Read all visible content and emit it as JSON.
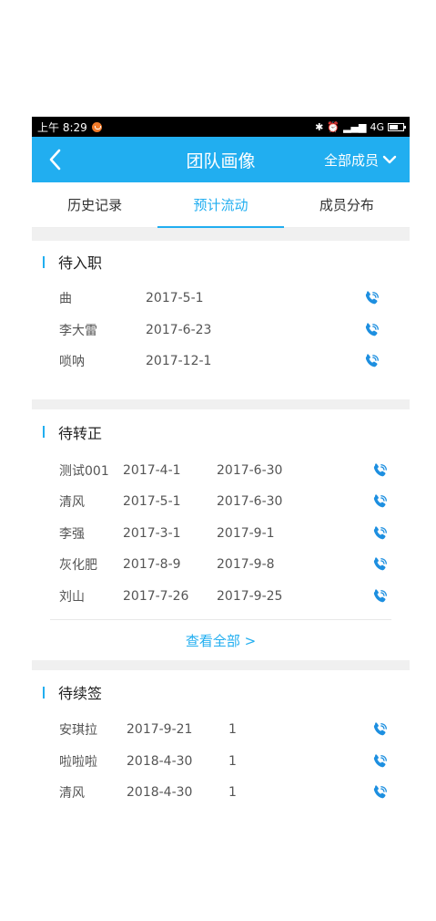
{
  "status_bar": {
    "time": "上午 8:29",
    "network": "4G"
  },
  "header": {
    "title": "团队画像",
    "member_filter": "全部成员"
  },
  "tabs": [
    {
      "label": "历史记录",
      "active": false
    },
    {
      "label": "预计流动",
      "active": true
    },
    {
      "label": "成员分布",
      "active": false
    }
  ],
  "sections": {
    "pending_entry": {
      "title": "待入职",
      "rows": [
        {
          "name": "曲",
          "date": "2017-5-1"
        },
        {
          "name": "李大雷",
          "date": "2017-6-23"
        },
        {
          "name": "唢呐",
          "date": "2017-12-1"
        }
      ]
    },
    "pending_regular": {
      "title": "待转正",
      "rows": [
        {
          "name": "测试001",
          "start": "2017-4-1",
          "end": "2017-6-30"
        },
        {
          "name": "清风",
          "start": "2017-5-1",
          "end": "2017-6-30"
        },
        {
          "name": "李强",
          "start": "2017-3-1",
          "end": "2017-9-1"
        },
        {
          "name": "灰化肥",
          "start": "2017-8-9",
          "end": "2017-9-8"
        },
        {
          "name": "刘山",
          "start": "2017-7-26",
          "end": "2017-9-25"
        }
      ],
      "view_all": "查看全部 >"
    },
    "pending_renewal": {
      "title": "待续签",
      "rows": [
        {
          "name": "安琪拉",
          "date": "2017-9-21",
          "count": "1"
        },
        {
          "name": "啦啦啦",
          "date": "2018-4-30",
          "count": "1"
        },
        {
          "name": "清风",
          "date": "2018-4-30",
          "count": "1"
        }
      ]
    }
  },
  "colors": {
    "accent": "#21aef0",
    "phone_icon": "#1d8fe0"
  }
}
